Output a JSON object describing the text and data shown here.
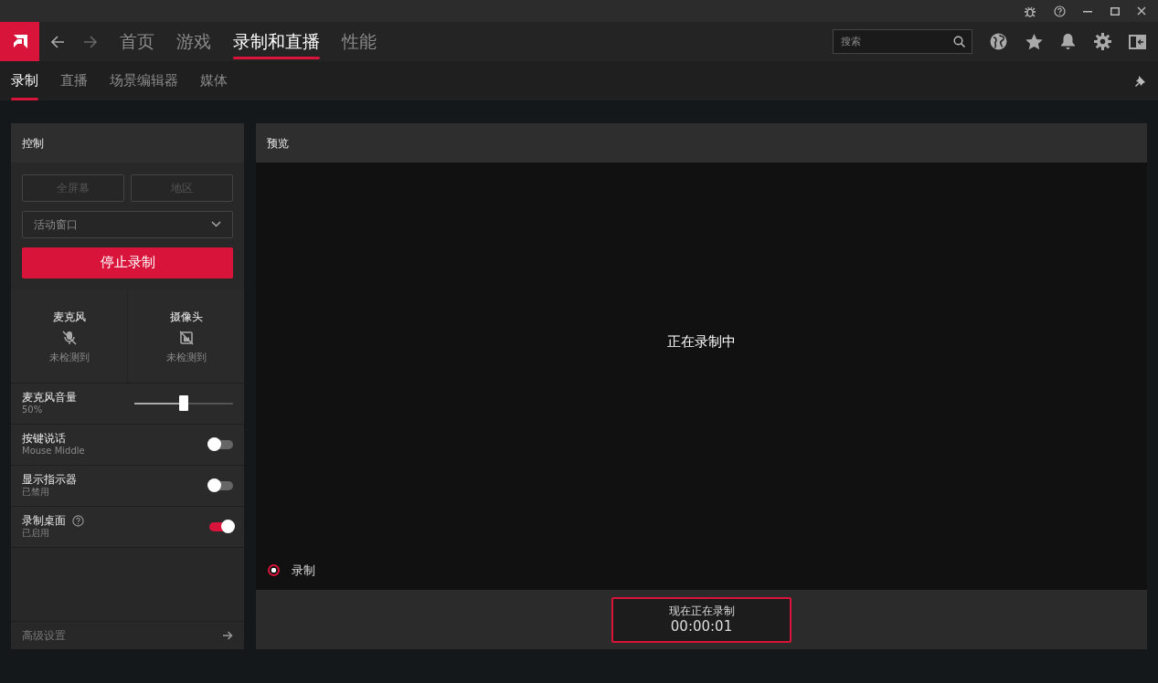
{
  "nav": {
    "tabs": [
      {
        "label": "首页",
        "selected": false
      },
      {
        "label": "游戏",
        "selected": false
      },
      {
        "label": "录制和直播",
        "selected": true
      },
      {
        "label": "性能",
        "selected": false
      }
    ],
    "search": {
      "placeholder": "搜索"
    }
  },
  "sub_tabs": [
    {
      "label": "录制",
      "selected": true
    },
    {
      "label": "直播",
      "selected": false
    },
    {
      "label": "场景编辑器",
      "selected": false
    },
    {
      "label": "媒体",
      "selected": false
    }
  ],
  "control_panel": {
    "title": "控制",
    "capture_buttons": [
      {
        "label": "全屏幕",
        "disabled": true
      },
      {
        "label": "地区",
        "disabled": true
      }
    ],
    "source_select": {
      "value": "活动窗口"
    },
    "action_button": "停止录制",
    "devices": [
      {
        "kind": "microphone",
        "name": "麦克风",
        "status": "未检测到"
      },
      {
        "kind": "camera",
        "name": "摄像头",
        "status": "未检测到"
      }
    ],
    "settings": [
      {
        "kind": "slider",
        "label": "麦克风音量",
        "sub": "50%",
        "level": 0.5
      },
      {
        "kind": "toggle",
        "label": "按键说话",
        "sub": "Mouse Middle",
        "on": false
      },
      {
        "kind": "toggle",
        "label": "显示指示器",
        "sub": "已禁用",
        "on": false
      },
      {
        "kind": "toggle",
        "label": "录制桌面",
        "sub": "已启用",
        "on": true,
        "help": true
      }
    ],
    "footer_link": "高级设置"
  },
  "preview": {
    "title": "预览",
    "message": "正在录制中",
    "indicator": {
      "label": "录制",
      "selected": true
    },
    "status": {
      "label": "现在正在录制",
      "time": "00:00:01"
    }
  }
}
